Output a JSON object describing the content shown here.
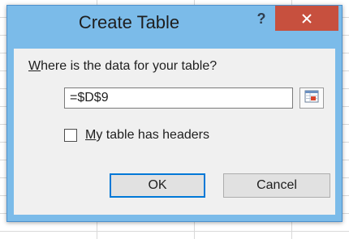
{
  "dialog": {
    "title": "Create Table",
    "help_label": "?",
    "prompt_mnemonic": "W",
    "prompt_rest": "here is the data for your table?",
    "range_value": "=$D$9",
    "headers_mnemonic": "M",
    "headers_rest": "y table has headers",
    "headers_checked": false,
    "ok_label": "OK",
    "cancel_label": "Cancel"
  },
  "icons": {
    "close": "close-icon",
    "collapse": "collapse-dialog-icon"
  },
  "colors": {
    "frame": "#7bbbe9",
    "close_button": "#c7503e",
    "client_area": "#f0f0f0",
    "default_button_border": "#0078d7"
  }
}
